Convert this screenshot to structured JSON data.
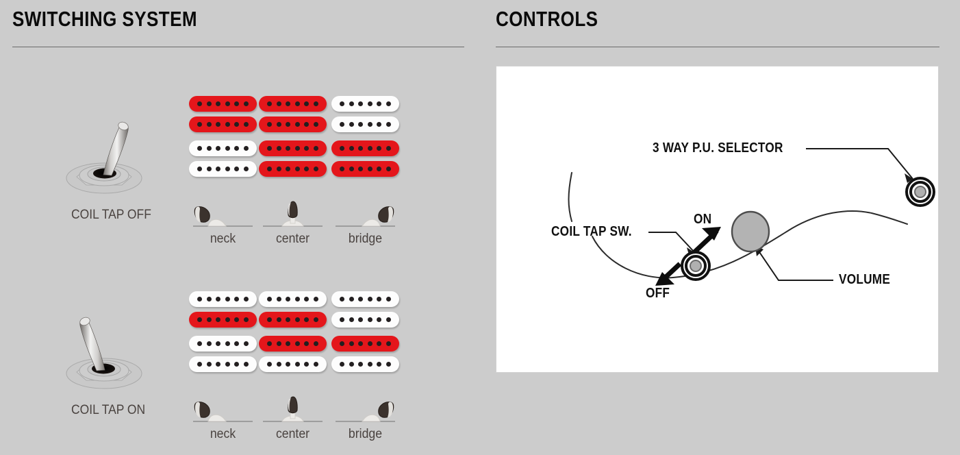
{
  "sections": {
    "switching": {
      "title": "SWITCHING SYSTEM"
    },
    "controls": {
      "title": "CONTROLS"
    }
  },
  "switching_system": {
    "rows": [
      {
        "mode_label": "COIL TAP OFF",
        "toggle_position": "right",
        "positions": [
          {
            "label": "neck",
            "selector": "neck",
            "upper_pickup": {
              "top_coil": "red",
              "bottom_coil": "red"
            },
            "lower_pickup": {
              "top_coil": "white",
              "bottom_coil": "white"
            }
          },
          {
            "label": "center",
            "selector": "center",
            "upper_pickup": {
              "top_coil": "red",
              "bottom_coil": "red"
            },
            "lower_pickup": {
              "top_coil": "red",
              "bottom_coil": "red"
            }
          },
          {
            "label": "bridge",
            "selector": "bridge",
            "upper_pickup": {
              "top_coil": "white",
              "bottom_coil": "white"
            },
            "lower_pickup": {
              "top_coil": "red",
              "bottom_coil": "red"
            }
          }
        ]
      },
      {
        "mode_label": "COIL TAP ON",
        "toggle_position": "left",
        "positions": [
          {
            "label": "neck",
            "selector": "neck",
            "upper_pickup": {
              "top_coil": "white",
              "bottom_coil": "red"
            },
            "lower_pickup": {
              "top_coil": "white",
              "bottom_coil": "white"
            }
          },
          {
            "label": "center",
            "selector": "center",
            "upper_pickup": {
              "top_coil": "white",
              "bottom_coil": "red"
            },
            "lower_pickup": {
              "top_coil": "red",
              "bottom_coil": "white"
            }
          },
          {
            "label": "bridge",
            "selector": "bridge",
            "upper_pickup": {
              "top_coil": "white",
              "bottom_coil": "white"
            },
            "lower_pickup": {
              "top_coil": "red",
              "bottom_coil": "white"
            }
          }
        ]
      }
    ],
    "poles_per_coil": 6
  },
  "controls_diagram": {
    "callouts": [
      {
        "id": "pu-selector",
        "label": "3 WAY P.U. SELECTOR"
      },
      {
        "id": "coil-tap-sw",
        "label": "COIL TAP SW."
      },
      {
        "id": "coil-tap-on",
        "label": "ON"
      },
      {
        "id": "coil-tap-off",
        "label": "OFF"
      },
      {
        "id": "volume",
        "label": "VOLUME"
      }
    ]
  },
  "colors": {
    "background": "#cccccc",
    "coil_active": "#e4161b",
    "coil_inactive": "#fdfdfd",
    "pole": "#231f20",
    "label_text": "#4a4340",
    "heading_text": "#0a0a0a",
    "rule": "#6b6b6b",
    "card_background": "#ffffff",
    "knob_fill": "#b3b3b3"
  }
}
